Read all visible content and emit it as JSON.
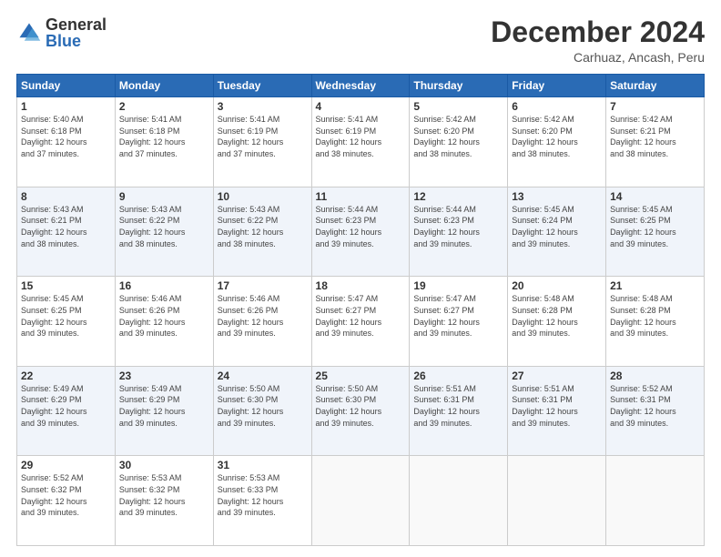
{
  "header": {
    "logo_general": "General",
    "logo_blue": "Blue",
    "month_title": "December 2024",
    "subtitle": "Carhuaz, Ancash, Peru"
  },
  "weekdays": [
    "Sunday",
    "Monday",
    "Tuesday",
    "Wednesday",
    "Thursday",
    "Friday",
    "Saturday"
  ],
  "weeks": [
    [
      {
        "day": "1",
        "info": "Sunrise: 5:40 AM\nSunset: 6:18 PM\nDaylight: 12 hours\nand 37 minutes."
      },
      {
        "day": "2",
        "info": "Sunrise: 5:41 AM\nSunset: 6:18 PM\nDaylight: 12 hours\nand 37 minutes."
      },
      {
        "day": "3",
        "info": "Sunrise: 5:41 AM\nSunset: 6:19 PM\nDaylight: 12 hours\nand 37 minutes."
      },
      {
        "day": "4",
        "info": "Sunrise: 5:41 AM\nSunset: 6:19 PM\nDaylight: 12 hours\nand 38 minutes."
      },
      {
        "day": "5",
        "info": "Sunrise: 5:42 AM\nSunset: 6:20 PM\nDaylight: 12 hours\nand 38 minutes."
      },
      {
        "day": "6",
        "info": "Sunrise: 5:42 AM\nSunset: 6:20 PM\nDaylight: 12 hours\nand 38 minutes."
      },
      {
        "day": "7",
        "info": "Sunrise: 5:42 AM\nSunset: 6:21 PM\nDaylight: 12 hours\nand 38 minutes."
      }
    ],
    [
      {
        "day": "8",
        "info": "Sunrise: 5:43 AM\nSunset: 6:21 PM\nDaylight: 12 hours\nand 38 minutes."
      },
      {
        "day": "9",
        "info": "Sunrise: 5:43 AM\nSunset: 6:22 PM\nDaylight: 12 hours\nand 38 minutes."
      },
      {
        "day": "10",
        "info": "Sunrise: 5:43 AM\nSunset: 6:22 PM\nDaylight: 12 hours\nand 38 minutes."
      },
      {
        "day": "11",
        "info": "Sunrise: 5:44 AM\nSunset: 6:23 PM\nDaylight: 12 hours\nand 39 minutes."
      },
      {
        "day": "12",
        "info": "Sunrise: 5:44 AM\nSunset: 6:23 PM\nDaylight: 12 hours\nand 39 minutes."
      },
      {
        "day": "13",
        "info": "Sunrise: 5:45 AM\nSunset: 6:24 PM\nDaylight: 12 hours\nand 39 minutes."
      },
      {
        "day": "14",
        "info": "Sunrise: 5:45 AM\nSunset: 6:25 PM\nDaylight: 12 hours\nand 39 minutes."
      }
    ],
    [
      {
        "day": "15",
        "info": "Sunrise: 5:45 AM\nSunset: 6:25 PM\nDaylight: 12 hours\nand 39 minutes."
      },
      {
        "day": "16",
        "info": "Sunrise: 5:46 AM\nSunset: 6:26 PM\nDaylight: 12 hours\nand 39 minutes."
      },
      {
        "day": "17",
        "info": "Sunrise: 5:46 AM\nSunset: 6:26 PM\nDaylight: 12 hours\nand 39 minutes."
      },
      {
        "day": "18",
        "info": "Sunrise: 5:47 AM\nSunset: 6:27 PM\nDaylight: 12 hours\nand 39 minutes."
      },
      {
        "day": "19",
        "info": "Sunrise: 5:47 AM\nSunset: 6:27 PM\nDaylight: 12 hours\nand 39 minutes."
      },
      {
        "day": "20",
        "info": "Sunrise: 5:48 AM\nSunset: 6:28 PM\nDaylight: 12 hours\nand 39 minutes."
      },
      {
        "day": "21",
        "info": "Sunrise: 5:48 AM\nSunset: 6:28 PM\nDaylight: 12 hours\nand 39 minutes."
      }
    ],
    [
      {
        "day": "22",
        "info": "Sunrise: 5:49 AM\nSunset: 6:29 PM\nDaylight: 12 hours\nand 39 minutes."
      },
      {
        "day": "23",
        "info": "Sunrise: 5:49 AM\nSunset: 6:29 PM\nDaylight: 12 hours\nand 39 minutes."
      },
      {
        "day": "24",
        "info": "Sunrise: 5:50 AM\nSunset: 6:30 PM\nDaylight: 12 hours\nand 39 minutes."
      },
      {
        "day": "25",
        "info": "Sunrise: 5:50 AM\nSunset: 6:30 PM\nDaylight: 12 hours\nand 39 minutes."
      },
      {
        "day": "26",
        "info": "Sunrise: 5:51 AM\nSunset: 6:31 PM\nDaylight: 12 hours\nand 39 minutes."
      },
      {
        "day": "27",
        "info": "Sunrise: 5:51 AM\nSunset: 6:31 PM\nDaylight: 12 hours\nand 39 minutes."
      },
      {
        "day": "28",
        "info": "Sunrise: 5:52 AM\nSunset: 6:31 PM\nDaylight: 12 hours\nand 39 minutes."
      }
    ],
    [
      {
        "day": "29",
        "info": "Sunrise: 5:52 AM\nSunset: 6:32 PM\nDaylight: 12 hours\nand 39 minutes."
      },
      {
        "day": "30",
        "info": "Sunrise: 5:53 AM\nSunset: 6:32 PM\nDaylight: 12 hours\nand 39 minutes."
      },
      {
        "day": "31",
        "info": "Sunrise: 5:53 AM\nSunset: 6:33 PM\nDaylight: 12 hours\nand 39 minutes."
      },
      null,
      null,
      null,
      null
    ]
  ]
}
